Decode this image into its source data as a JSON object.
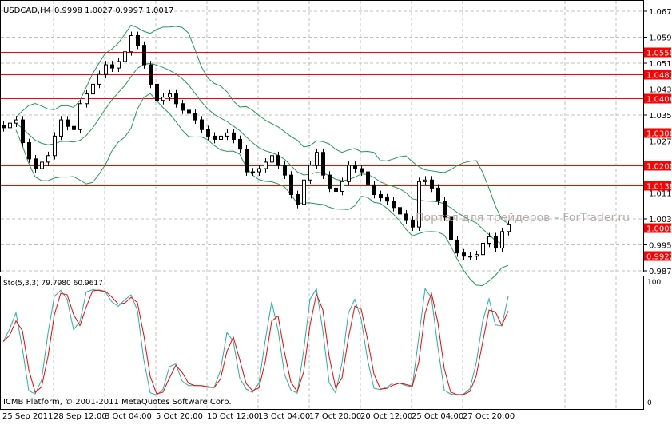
{
  "header": {
    "symbol": "USDCAD,H4",
    "ohlc": "0.9998 1.0027 0.9997 1.0017"
  },
  "watermark": "Портал для трейдеров – ForTrader.ru",
  "copyright": "ICMB Platform, © 2001-2011 MetaQuotes Software Corp.",
  "colors": {
    "bands": "#1a9e50",
    "level_line": "#ff0000",
    "stoch_main": "#20b2aa",
    "stoch_signal": "#ff0000",
    "candle": "#000000"
  },
  "chart_data": [
    {
      "type": "candlestick",
      "symbol": "USDCAD",
      "timeframe": "H4",
      "ylim": [
        0.985,
        1.071
      ],
      "yticks": [
        "1.0675",
        "1.0595",
        "1.0515",
        "1.0435",
        "1.0355",
        "1.0275",
        "1.0115",
        "1.0035",
        "0.9955",
        "0.9875"
      ],
      "close": [
        1.0316,
        1.033,
        1.034,
        1.027,
        1.022,
        1.019,
        1.021,
        1.023,
        1.029,
        1.034,
        1.032,
        1.031,
        1.039,
        1.042,
        1.045,
        1.048,
        1.051,
        1.05,
        1.052,
        1.055,
        1.06,
        1.057,
        1.051,
        1.045,
        1.04,
        1.041,
        1.042,
        1.039,
        1.037,
        1.036,
        1.034,
        1.031,
        1.029,
        1.028,
        1.029,
        1.03,
        1.028,
        1.025,
        1.018,
        1.018,
        1.019,
        1.021,
        1.023,
        1.02,
        1.017,
        1.011,
        1.008,
        1.0155,
        1.02,
        1.024,
        1.017,
        1.013,
        1.012,
        1.015,
        1.02,
        1.019,
        1.018,
        1.014,
        1.011,
        1.01,
        1.009,
        1.007,
        1.005,
        1.003,
        1.001,
        1.015,
        1.0155,
        1.013,
        1.009,
        1.004,
        0.997,
        0.993,
        0.992,
        0.992,
        0.9925,
        0.996,
        0.998,
        0.9945,
        0.9996,
        1.0017
      ],
      "levels": [
        "1.0550",
        "1.0481",
        "1.0406",
        "1.0300",
        "1.0200",
        "1.0138",
        "1.0008",
        "0.9922"
      ],
      "indicators": [
        "Bollinger Bands"
      ],
      "xticks": [
        "25 Sep 2011",
        "28 Sep 12:00",
        "3 Oct 04:00",
        "5 Oct 20:00",
        "10 Oct 12:00",
        "13 Oct 04:00",
        "17 Oct 20:00",
        "20 Oct 12:00",
        "25 Oct 04:00",
        "27 Oct 20:00"
      ],
      "grid": true
    },
    {
      "type": "line",
      "title": "Sto(5,3,3) 79.7980 60.9617",
      "ylim": [
        0,
        100
      ],
      "yticks": [
        "100",
        "0"
      ],
      "series": [
        {
          "name": "main"
        },
        {
          "name": "signal"
        }
      ]
    }
  ]
}
